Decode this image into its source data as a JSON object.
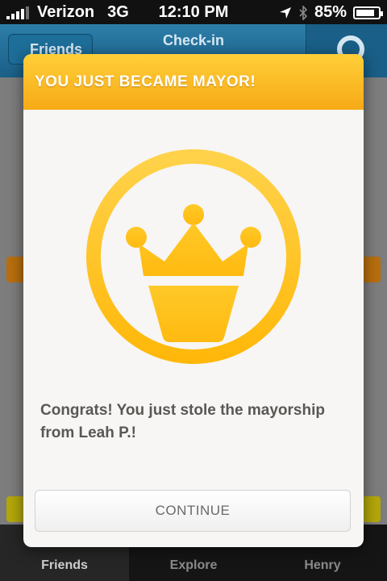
{
  "status_bar": {
    "carrier": "Verizon",
    "network": "3G",
    "time": "12:10 PM",
    "battery_percent": "85%",
    "battery_level": 0.85,
    "icons": [
      "signal-bars-icon",
      "location-arrow-icon",
      "bluetooth-icon",
      "battery-icon"
    ]
  },
  "nav": {
    "back_label": "Friends",
    "title": "Check-in",
    "right_icon": "gear-icon"
  },
  "modal": {
    "title": "YOU JUST BECAME MAYOR!",
    "badge_icon": "crown-icon",
    "message": "Congrats! You just stole the mayorship from Leah P.!",
    "continue_label": "CONTINUE"
  },
  "tabs": [
    {
      "label": "Friends",
      "icon": "friends-icon",
      "active": true
    },
    {
      "label": "Explore",
      "icon": "search-icon",
      "active": false
    },
    {
      "label": "Henry",
      "icon": "profile-icon",
      "active": false
    }
  ],
  "colors": {
    "header_top": "#ffcf38",
    "header_bottom": "#f6aa16",
    "badge_gold": "#ffc20e",
    "navbar": "#1a5f87"
  }
}
